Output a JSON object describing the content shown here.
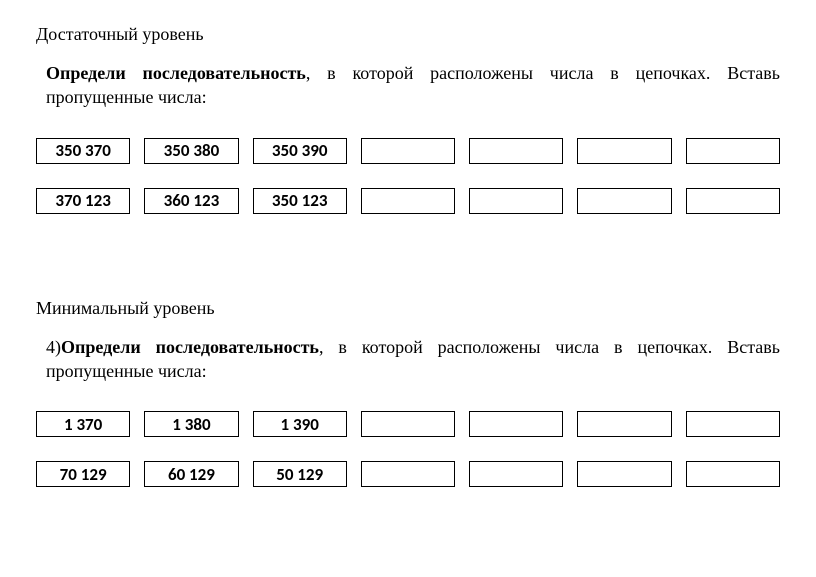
{
  "section1": {
    "level": "Достаточный уровень",
    "instruction_bold": "Определи последовательность",
    "instruction_rest": ", в которой расположены числа в цепочках. Вставь пропущенные числа:",
    "rows": [
      {
        "cells": [
          "350 370",
          "350 380",
          "350 390",
          "",
          "",
          "",
          ""
        ]
      },
      {
        "cells": [
          "370 123",
          "360 123",
          "350 123",
          "",
          "",
          "",
          ""
        ]
      }
    ]
  },
  "section2": {
    "level": "Минимальный уровень",
    "instruction_prefix": "4)",
    "instruction_bold": "Определи последовательность",
    "instruction_rest": ", в которой расположены числа в цепочках. Вставь пропущенные числа:",
    "rows": [
      {
        "cells": [
          "1 370",
          "1 380",
          "1 390",
          "",
          "",
          "",
          ""
        ]
      },
      {
        "cells": [
          "70 129",
          "60 129",
          "50 129",
          "",
          "",
          "",
          ""
        ]
      }
    ]
  }
}
